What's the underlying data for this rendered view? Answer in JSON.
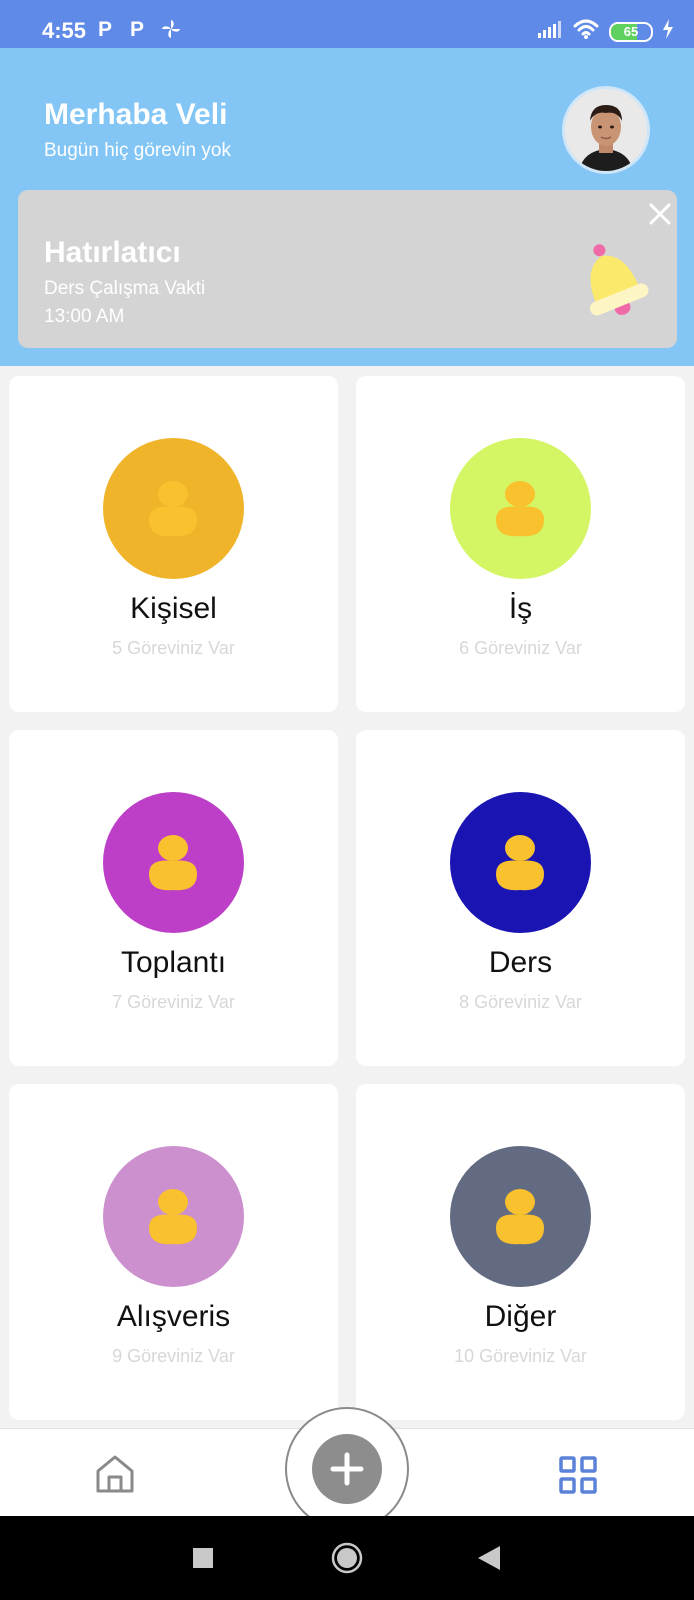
{
  "status_bar": {
    "time": "4:55",
    "icons": [
      "parking-p-icon",
      "parking-p-icon",
      "fan-icon",
      "signal-icon",
      "wifi-icon",
      "battery-icon",
      "charging-icon"
    ],
    "battery_level": "65"
  },
  "header": {
    "greeting": "Merhaba Veli",
    "subtitle": "Bugün hiç görevin yok"
  },
  "reminder": {
    "title": "Hatırlatıcı",
    "description": "Ders Çalışma Vakti",
    "time": "13:00 AM"
  },
  "categories": [
    {
      "name": "Kişisel",
      "count": "5 Göreviniz Var",
      "color": "#f0b42a"
    },
    {
      "name": "İş",
      "count": "6 Göreviniz Var",
      "color": "#d4f564"
    },
    {
      "name": "Toplantı",
      "count": "7 Göreviniz Var",
      "color": "#bd3fc7"
    },
    {
      "name": "Ders",
      "count": "8 Göreviniz Var",
      "color": "#1a14b3"
    },
    {
      "name": "Alışveris",
      "count": "9 Göreviniz Var",
      "color": "#cc90cf"
    },
    {
      "name": "Diğer",
      "count": "10 Göreviniz Var",
      "color": "#636b82"
    }
  ],
  "colors": {
    "status_bar": "#5f8ae8",
    "header": "#83c6f5",
    "reminder_card": "#d4d4d4",
    "person_icon": "#f9c12e",
    "grid_icon_blue": "#5b82d9"
  }
}
